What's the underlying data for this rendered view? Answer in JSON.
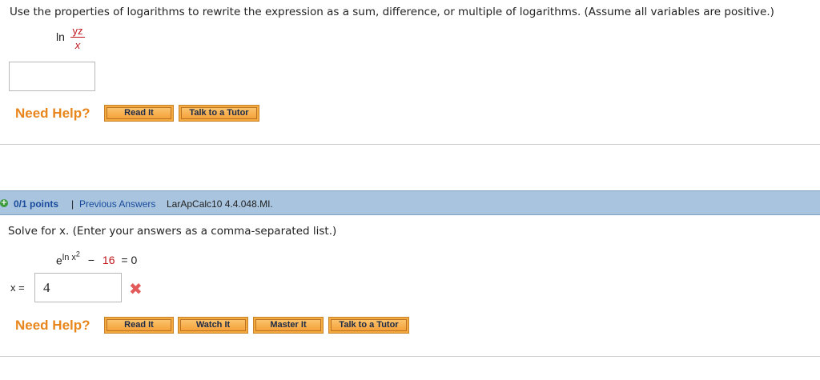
{
  "q1": {
    "prompt": "Use the properties of logarithms to rewrite the expression as a sum, difference, or multiple of logarithms. (Assume all variables are positive.)",
    "ln": "ln",
    "numerator": "yz",
    "denominator": "x",
    "answer_value": "",
    "need_help": "Need Help?",
    "buttons": [
      "Read It",
      "Talk to a Tutor"
    ]
  },
  "q2": {
    "points": "0/1 points",
    "separator": "|",
    "previous_answers": "Previous Answers",
    "problem_id": "LarApCalc10 4.4.048.MI.",
    "prompt": "Solve for x. (Enter your answers as a comma-separated list.)",
    "eq_base": "e",
    "eq_exp": "ln x",
    "eq_exp_sup": "2",
    "eq_minus": "−",
    "eq_num": "16",
    "eq_rest": "= 0",
    "answer_label": "x =",
    "answer_value": "4",
    "incorrect_icon": "✖",
    "need_help": "Need Help?",
    "buttons": [
      "Read It",
      "Watch It",
      "Master It",
      "Talk to a Tutor"
    ]
  },
  "colors": {
    "header_bg": "#a8c4de",
    "need_help": "#e8861c",
    "button_bg": "#f5a13a",
    "red": "#c0161c",
    "incorrect": "#e25a5a"
  }
}
